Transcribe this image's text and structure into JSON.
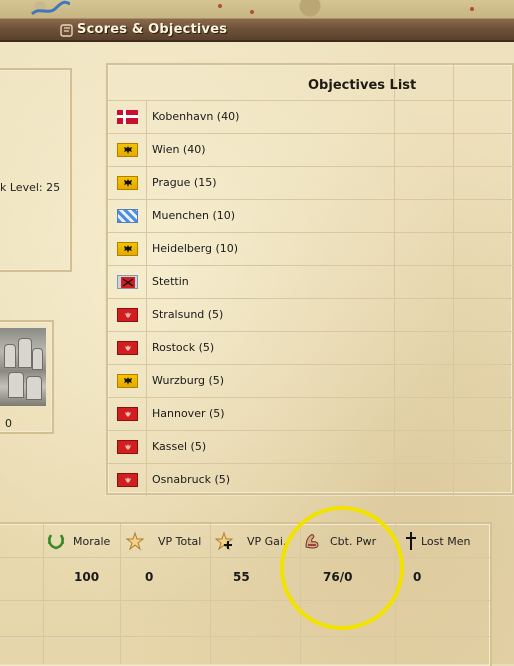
{
  "window": {
    "title": "Scores & Objectives"
  },
  "left_panel": {
    "level_text": "k Level: 25",
    "photo_count": "0"
  },
  "objectives": {
    "title": "Objectives List",
    "items": [
      {
        "name": "Kobenhavn (40)",
        "flag": "denmark"
      },
      {
        "name": "Wien (40)",
        "flag": "austria"
      },
      {
        "name": "Prague (15)",
        "flag": "austria"
      },
      {
        "name": "Muenchen (10)",
        "flag": "bavaria"
      },
      {
        "name": "Heidelberg (10)",
        "flag": "austria"
      },
      {
        "name": "Stettin",
        "flag": "sweden"
      },
      {
        "name": "Stralsund (5)",
        "flag": "prussia"
      },
      {
        "name": "Rostock (5)",
        "flag": "prussia"
      },
      {
        "name": "Wurzburg (5)",
        "flag": "austria"
      },
      {
        "name": "Hannover (5)",
        "flag": "prussia"
      },
      {
        "name": "Kassel (5)",
        "flag": "prussia"
      },
      {
        "name": "Osnabruck (5)",
        "flag": "prussia"
      }
    ]
  },
  "stats": {
    "headers": {
      "morale": "Morale",
      "vp_total": "VP Total",
      "vp_gain": "VP Gai.",
      "cbt_pwr": "Cbt. Pwr",
      "lost_men": "Lost Men"
    },
    "values": {
      "morale": "100",
      "vp_total": "0",
      "vp_gain": "55",
      "cbt_pwr": "76/0",
      "lost_men": "0"
    }
  },
  "icons": {
    "title": "scroll-icon",
    "morale": "laurel-wreath-icon",
    "vp_total": "star-icon",
    "vp_gain": "star-plus-icon",
    "cbt_pwr": "flexed-arm-icon",
    "lost_men": "cross-icon"
  },
  "colors": {
    "parchment": "#e9dcb6",
    "titlebar": "#6f5239",
    "highlight": "#f2e200"
  }
}
